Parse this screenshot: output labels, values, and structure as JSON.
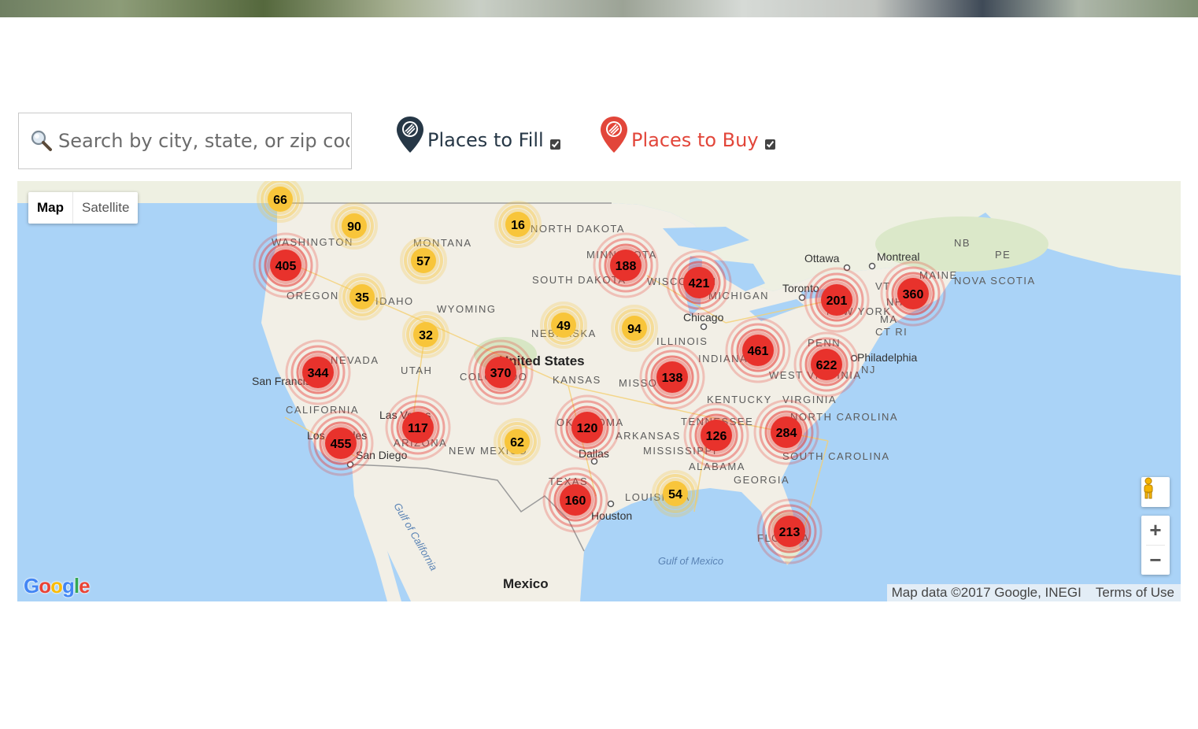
{
  "search": {
    "placeholder": "Search by city, state, or zip code",
    "icon": "magnifier-icon"
  },
  "filters": [
    {
      "label": "Places to Fill",
      "checked": true,
      "color": "#263746",
      "icon": "fill-pin-icon"
    },
    {
      "label": "Places to Buy",
      "checked": true,
      "color": "#e2463a",
      "icon": "buy-pin-icon"
    }
  ],
  "map": {
    "type_controls": {
      "map": "Map",
      "satellite": "Satellite",
      "active": "Map"
    },
    "zoom": {
      "in": "+",
      "out": "−"
    },
    "attribution": "Map data ©2017 Google, INEGI",
    "terms": "Terms of Use",
    "logo": "Google",
    "colors": {
      "water": "#aad3f7",
      "land": "#f2efe6",
      "large_cluster": "#e8322c",
      "small_cluster": "#f8c53a"
    },
    "country_labels": [
      "United States",
      "Mexico"
    ],
    "region_labels": [
      "WASHINGTON",
      "OREGON",
      "IDAHO",
      "MONTANA",
      "NORTH DAKOTA",
      "SOUTH DAKOTA",
      "WYOMING",
      "NEVADA",
      "UTAH",
      "COLORADO",
      "CALIFORNIA",
      "ARIZONA",
      "NEW MEXICO",
      "NEBRASKA",
      "KANSAS",
      "MINNESOTA",
      "WISCONSIN",
      "MICHIGAN",
      "ILLINOIS",
      "INDIANA",
      "MISSOURI",
      "KENTUCKY",
      "TENNESSEE",
      "ARKANSAS",
      "MISSISSIPPI",
      "ALABAMA",
      "GEORGIA",
      "TEXAS",
      "LOUISIANA",
      "OKLAHOMA",
      "WEST VIRGINIA",
      "VIRGINIA",
      "NORTH CAROLINA",
      "SOUTH CAROLINA",
      "FLORIDA",
      "PENN",
      "NEW YORK",
      "MAINE",
      "VT",
      "NH",
      "MA",
      "CT RI",
      "NJ",
      "NB",
      "PE",
      "NOVA SCOTIA"
    ],
    "city_labels": [
      "San Francisco",
      "Los Angeles",
      "San Diego",
      "Las Vegas",
      "Dallas",
      "Houston",
      "Chicago",
      "Toronto",
      "Ottawa",
      "Montreal",
      "Philadelphia"
    ],
    "water_labels": [
      "Gulf of California",
      "Gulf of Mexico"
    ],
    "clusters": [
      {
        "count": "66",
        "kind": "small"
      },
      {
        "count": "90",
        "kind": "small"
      },
      {
        "count": "16",
        "kind": "small"
      },
      {
        "count": "57",
        "kind": "small"
      },
      {
        "count": "35",
        "kind": "small"
      },
      {
        "count": "32",
        "kind": "small"
      },
      {
        "count": "49",
        "kind": "small"
      },
      {
        "count": "94",
        "kind": "small"
      },
      {
        "count": "62",
        "kind": "small"
      },
      {
        "count": "54",
        "kind": "small"
      },
      {
        "count": "405",
        "kind": "large"
      },
      {
        "count": "188",
        "kind": "large"
      },
      {
        "count": "421",
        "kind": "large"
      },
      {
        "count": "201",
        "kind": "large"
      },
      {
        "count": "360",
        "kind": "large"
      },
      {
        "count": "344",
        "kind": "large"
      },
      {
        "count": "370",
        "kind": "large"
      },
      {
        "count": "461",
        "kind": "large"
      },
      {
        "count": "622",
        "kind": "large"
      },
      {
        "count": "138",
        "kind": "large"
      },
      {
        "count": "117",
        "kind": "large"
      },
      {
        "count": "120",
        "kind": "large"
      },
      {
        "count": "126",
        "kind": "large"
      },
      {
        "count": "284",
        "kind": "large"
      },
      {
        "count": "455",
        "kind": "large"
      },
      {
        "count": "160",
        "kind": "large"
      },
      {
        "count": "213",
        "kind": "large"
      }
    ]
  }
}
